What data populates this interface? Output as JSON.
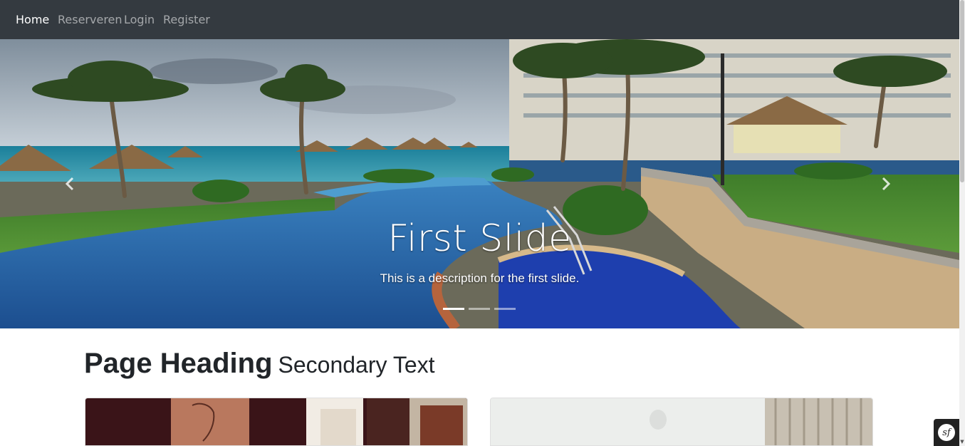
{
  "nav": {
    "items": [
      {
        "label": "Home",
        "active": true
      },
      {
        "label": "Reserveren",
        "active": false
      },
      {
        "label": "Login",
        "active": false
      },
      {
        "label": "Register",
        "active": false
      }
    ]
  },
  "carousel": {
    "slides": [
      {
        "title": "First Slide",
        "description": "This is a description for the first slide."
      }
    ],
    "indicator_count": 3,
    "active_index": 0,
    "prev_icon": "chevron-left-icon",
    "next_icon": "chevron-right-icon"
  },
  "heading": {
    "title": "Page Heading",
    "secondary": "Secondary Text"
  },
  "toolbar": {
    "icon": "symfony-logo-icon",
    "logo_text": "sf"
  },
  "colors": {
    "navbar_bg": "#343a40",
    "nav_active": "#ffffff",
    "nav_inactive": "rgba(255,255,255,0.55)",
    "heading_text": "#212529"
  }
}
